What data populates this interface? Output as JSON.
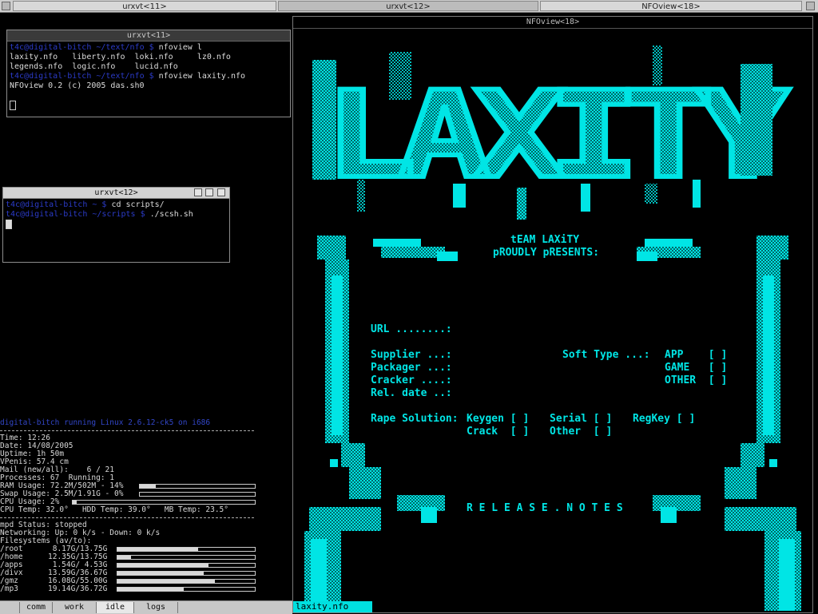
{
  "top_tabs": [
    {
      "label": "urxvt<11>",
      "active": false
    },
    {
      "label": "urxvt<12>",
      "active": true
    },
    {
      "label": "NFOview<18>",
      "active": false
    }
  ],
  "win1": {
    "title": "urxvt<11>",
    "lines": [
      {
        "prompt": "t4c@digital-bitch",
        "path": " ~/text/nfo $ ",
        "cmd": "nfoview l"
      },
      {
        "text": "laxity.nfo   liberty.nfo  loki.nfo     lz0.nfo"
      },
      {
        "text": "legends.nfo  logic.nfo    lucid.nfo"
      },
      {
        "prompt": "t4c@digital-bitch",
        "path": " ~/text/nfo $ ",
        "cmd": "nfoview laxity.nfo"
      },
      {
        "text": "NFOview 0.2 (c) 2005 das.sh0"
      }
    ]
  },
  "win2": {
    "title": "urxvt<12>",
    "lines": [
      {
        "prompt": "t4c@digital-bitch",
        "path": " ~ $ ",
        "cmd": "cd scripts/"
      },
      {
        "prompt": "t4c@digital-bitch",
        "path": " ~/scripts $ ",
        "cmd": "./scsh.sh"
      }
    ]
  },
  "conky": {
    "header": "digital-bitch running Linux 2.6.12-ck5 on i686",
    "time": "Time: 12:26",
    "date": "Date: 14/08/2005",
    "uptime": "Uptime: 1h 50m",
    "vpenis": "VPenis: 57.4 cm",
    "mail": "Mail (new/all):    6 / 21",
    "processes": "Processes: 67  Running: 1",
    "ram": {
      "label": "RAM Usage: 72.2M/502M - 14%",
      "percent": 14
    },
    "swap": {
      "label": "Swap Usage: 2.5M/1.91G - 0%",
      "percent": 0
    },
    "cpu": {
      "label": "CPU Usage: 2%",
      "percent": 2
    },
    "temps": "CPU Temp: 32.0°   HDD Temp: 39.0°   MB Temp: 23.5°",
    "mpd": "mpd Status: stopped",
    "net": "Networking: Up: 0 k/s - Down: 0 k/s",
    "fs_header": "Filesystems (av/to):",
    "filesystems": [
      {
        "mount": "/root",
        "usage": " 8.17G/13.75G",
        "percent": 59
      },
      {
        "mount": "/home",
        "usage": "12.35G/13.75G",
        "percent": 10
      },
      {
        "mount": "/apps",
        "usage": " 1.54G/ 4.53G",
        "percent": 66
      },
      {
        "mount": "/divx",
        "usage": "13.59G/36.67G",
        "percent": 63
      },
      {
        "mount": "/gmz",
        "usage": "16.08G/55.00G",
        "percent": 71
      },
      {
        "mount": "/mp3",
        "usage": "19.14G/36.72G",
        "percent": 48
      }
    ]
  },
  "bottom_tabs": [
    {
      "label": "comm",
      "active": false
    },
    {
      "label": "work",
      "active": false
    },
    {
      "label": "idle",
      "active": true
    },
    {
      "label": "logs",
      "active": false
    }
  ],
  "nfo": {
    "title": "NFOview<18>",
    "logo_text": "LAXITY",
    "intro_1": "tEAM LAXiTY",
    "intro_2": "pROUDLY pRESENTS:",
    "url": "URL ........:",
    "supplier": "Supplier ...:",
    "packager": "Packager ...:",
    "cracker": "Cracker ....:",
    "reldate": "Rel. date ..:",
    "soft_type": "Soft Type ...:",
    "type_app": "APP    [ ]",
    "type_game": "GAME   [ ]",
    "type_other": "OTHER  [ ]",
    "rape_solution": "Rape Solution:",
    "keygen": "Keygen [ ]",
    "serial": "Serial [ ]",
    "regkey": "RegKey [ ]",
    "crack": "Crack  [ ]",
    "other": "Other  [ ]",
    "release_notes": "R E L E A S E . N O T E S",
    "status": "laxity.nfo"
  },
  "colors": {
    "nfo": "#00e5e5",
    "prompt": "#2b3bc8",
    "background": "#000000"
  }
}
